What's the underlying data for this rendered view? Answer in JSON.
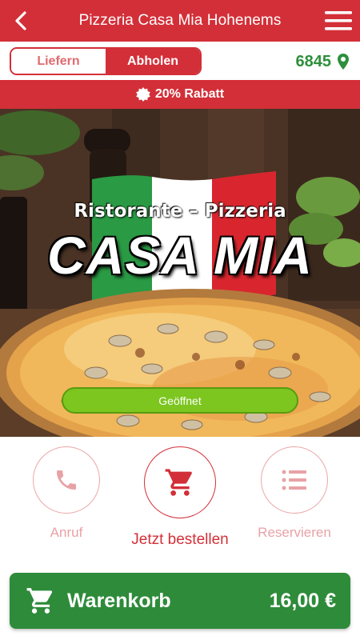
{
  "header": {
    "title": "Pizzeria Casa Mia Hohenems",
    "back_icon": "back-arrow-icon",
    "menu_icon": "hamburger-menu-icon"
  },
  "order_mode": {
    "options": [
      "Liefern",
      "Abholen"
    ],
    "selected": "Abholen"
  },
  "location": {
    "postal_code": "6845",
    "icon": "location-pin-icon"
  },
  "discount": {
    "text": "20% Rabatt",
    "icon": "discount-badge-icon"
  },
  "hero": {
    "subtitle": "Ristorante – Pizzeria",
    "name": "CASA MIA",
    "status": "Geöffnet"
  },
  "actions": [
    {
      "label": "Anruf",
      "icon": "phone-icon"
    },
    {
      "label": "Jetzt bestellen",
      "icon": "cart-icon"
    },
    {
      "label": "Reservieren",
      "icon": "list-icon"
    }
  ],
  "cart": {
    "label": "Warenkorb",
    "total": "16,00 €",
    "icon": "cart-icon"
  },
  "colors": {
    "brand_red": "#d32f38",
    "green": "#2e8b3a",
    "status_green": "#7cc61f"
  }
}
